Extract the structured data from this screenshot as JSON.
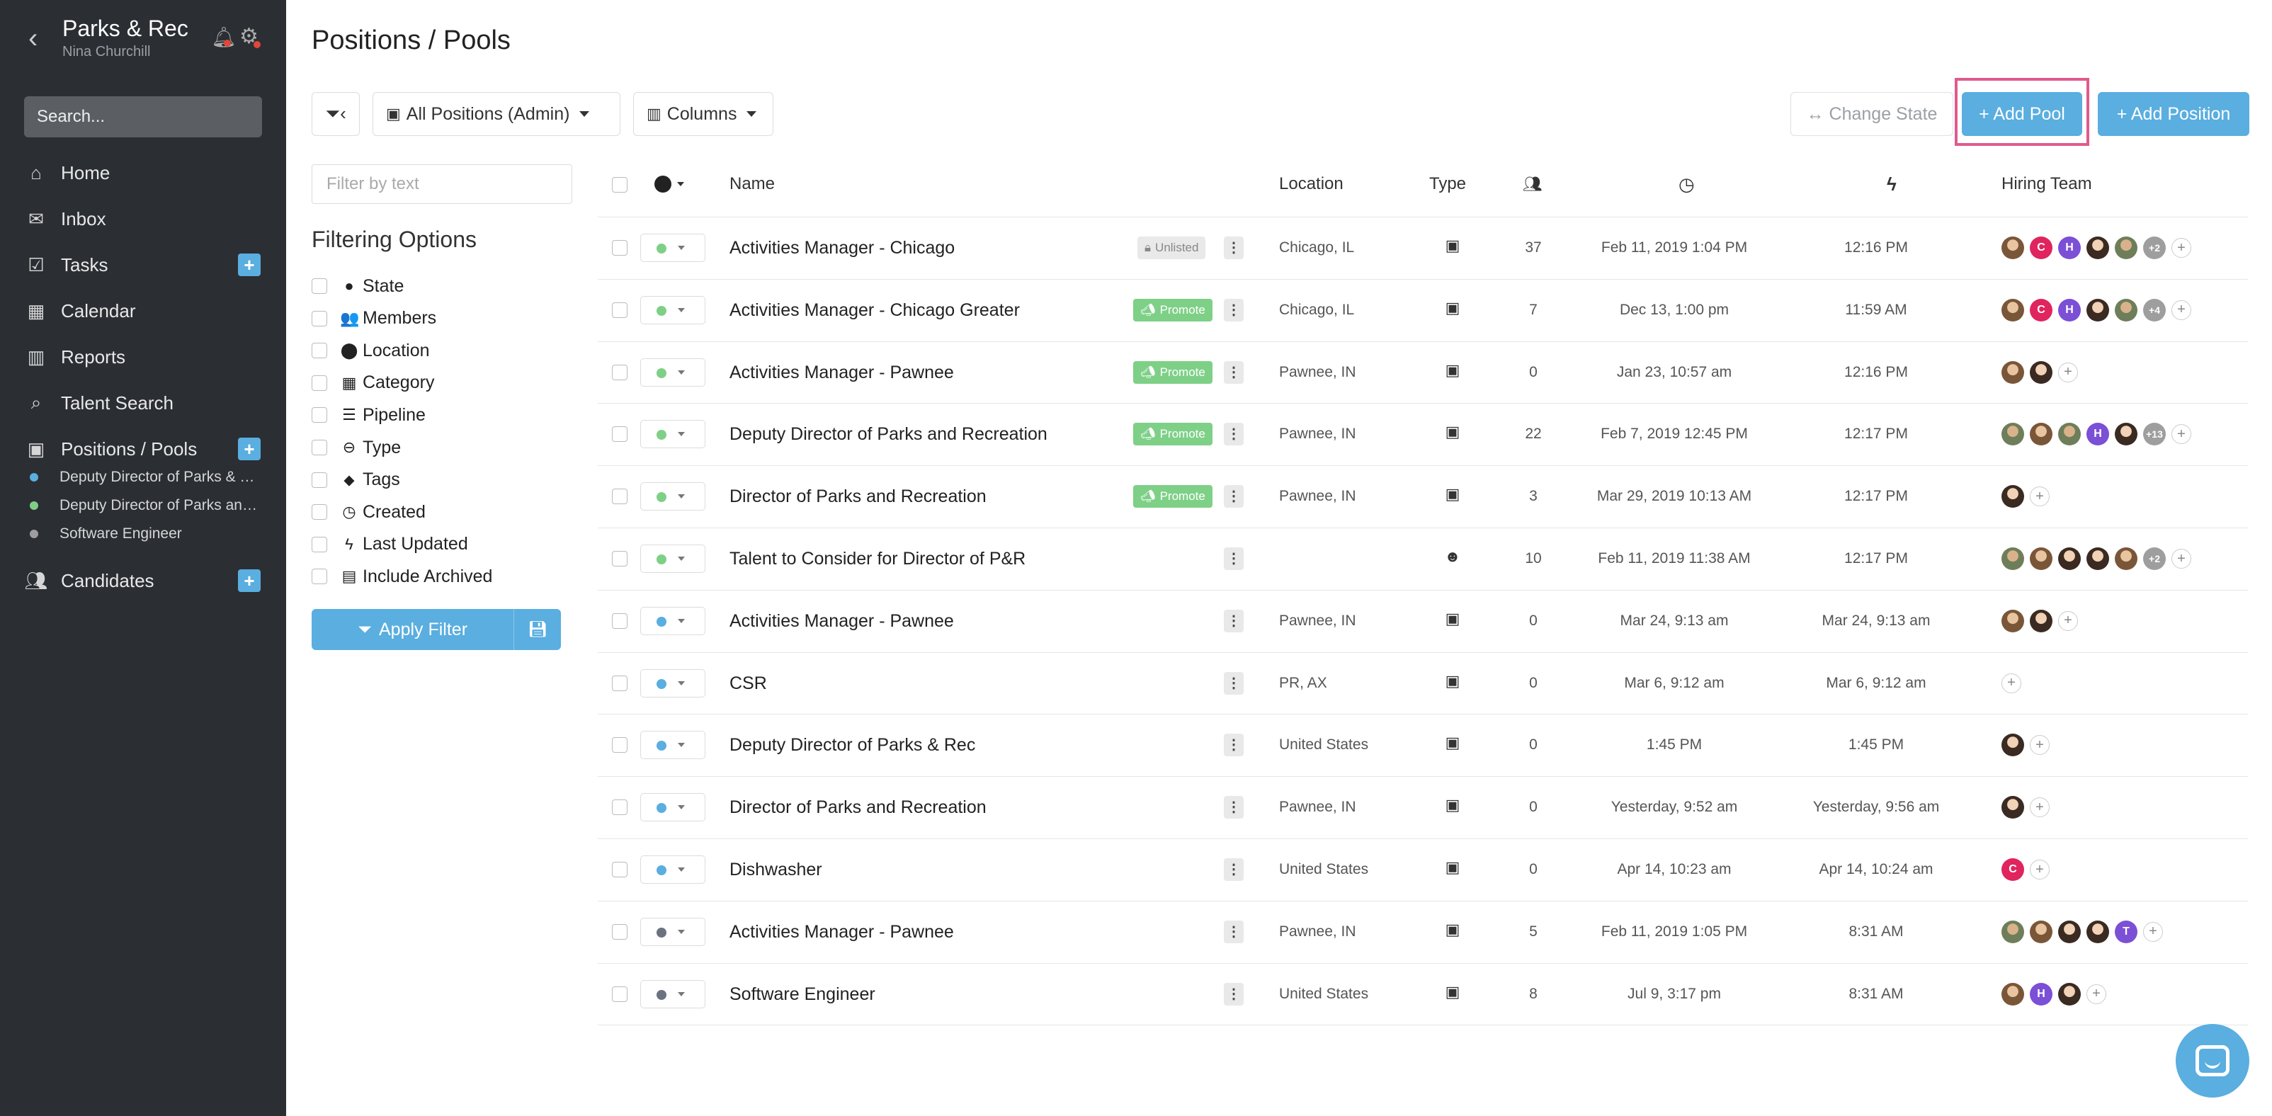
{
  "sidebar": {
    "back_icon": "chevron-left-icon",
    "org_name": "Parks & Rec",
    "user_name": "Nina Churchill",
    "search_placeholder": "Search...",
    "items": [
      {
        "label": "Home",
        "icon": "home-icon"
      },
      {
        "label": "Inbox",
        "icon": "envelope-icon"
      },
      {
        "label": "Tasks",
        "icon": "checkbox-icon"
      },
      {
        "label": "Calendar",
        "icon": "calendar-icon"
      },
      {
        "label": "Reports",
        "icon": "bar-chart-icon"
      },
      {
        "label": "Talent Search",
        "icon": "search-icon"
      },
      {
        "label": "Positions / Pools",
        "icon": "briefcase-icon"
      },
      {
        "label": "Candidates",
        "icon": "users-icon"
      }
    ],
    "sub_items": [
      {
        "label": "Deputy Director of Parks & Recreation",
        "color": "#5aaee0"
      },
      {
        "label": "Deputy Director of Parks and Recreation",
        "color": "#7ed087"
      },
      {
        "label": "Software Engineer",
        "color": "#9e9e9e"
      }
    ],
    "plus": "+"
  },
  "header": {
    "title": "Positions / Pools",
    "view_select": "All Positions (Admin)",
    "columns_label": "Columns",
    "change_state": "↔ Change State",
    "add_pool": "+ Add Pool",
    "add_position": "+ Add Position"
  },
  "filters": {
    "text_placeholder": "Filter by text",
    "title": "Filtering Options",
    "options": [
      {
        "label": "State",
        "icon": "●"
      },
      {
        "label": "Members",
        "icon": "👥"
      },
      {
        "label": "Location",
        "icon": "⬤"
      },
      {
        "label": "Category",
        "icon": "▦"
      },
      {
        "label": "Pipeline",
        "icon": "☰"
      },
      {
        "label": "Type",
        "icon": "⊖"
      },
      {
        "label": "Tags",
        "icon": "⬥"
      },
      {
        "label": "Created",
        "icon": "◷"
      },
      {
        "label": "Last Updated",
        "icon": "ϟ"
      },
      {
        "label": "Include Archived",
        "icon": "▤"
      }
    ],
    "apply_label": "Apply Filter"
  },
  "table": {
    "columns": {
      "name": "Name",
      "location": "Location",
      "type": "Type",
      "hiring_team": "Hiring Team"
    },
    "rows": [
      {
        "name": "Activities Manager - Chicago",
        "badge": "Unlisted",
        "location": "Chicago, IL",
        "type": "briefcase",
        "members": "37",
        "created": "Feb 11, 2019 1:04 PM",
        "updated": "12:16 PM",
        "state": "#7ed087",
        "team": [
          "p1",
          "C",
          "H",
          "p2",
          "p3",
          "+2"
        ]
      },
      {
        "name": "Activities Manager - Chicago Greater",
        "badge": "Promote",
        "location": "Chicago, IL",
        "type": "briefcase",
        "members": "7",
        "created": "Dec 13, 1:00 pm",
        "updated": "11:59 AM",
        "state": "#7ed087",
        "team": [
          "p1",
          "C",
          "H",
          "p2",
          "p3",
          "+4"
        ]
      },
      {
        "name": "Activities Manager - Pawnee",
        "badge": "Promote",
        "location": "Pawnee, IN",
        "type": "briefcase",
        "members": "0",
        "created": "Jan 23, 10:57 am",
        "updated": "12:16 PM",
        "state": "#7ed087",
        "team": [
          "p1",
          "p2"
        ]
      },
      {
        "name": "Deputy Director of Parks and Recreation",
        "badge": "Promote",
        "location": "Pawnee, IN",
        "type": "briefcase",
        "members": "22",
        "created": "Feb 7, 2019 12:45 PM",
        "updated": "12:17 PM",
        "state": "#7ed087",
        "team": [
          "p3",
          "p1",
          "p3",
          "H",
          "p2",
          "+13"
        ]
      },
      {
        "name": "Director of Parks and Recreation",
        "badge": "Promote",
        "location": "Pawnee, IN",
        "type": "briefcase",
        "members": "3",
        "created": "Mar 29, 2019 10:13 AM",
        "updated": "12:17 PM",
        "state": "#7ed087",
        "team": [
          "p2"
        ]
      },
      {
        "name": "Talent to Consider for Director of P&R",
        "badge": "",
        "location": "",
        "type": "user",
        "members": "10",
        "created": "Feb 11, 2019 11:38 AM",
        "updated": "12:17 PM",
        "state": "#7ed087",
        "team": [
          "p3",
          "p1",
          "p2",
          "p2",
          "p1",
          "+2"
        ]
      },
      {
        "name": "Activities Manager - Pawnee",
        "badge": "",
        "location": "Pawnee, IN",
        "type": "briefcase",
        "members": "0",
        "created": "Mar 24, 9:13 am",
        "updated": "Mar 24, 9:13 am",
        "state": "#5aaee0",
        "team": [
          "p1",
          "p2"
        ]
      },
      {
        "name": "CSR",
        "badge": "",
        "location": "PR, AX",
        "type": "briefcase",
        "members": "0",
        "created": "Mar 6, 9:12 am",
        "updated": "Mar 6, 9:12 am",
        "state": "#5aaee0",
        "team": []
      },
      {
        "name": "Deputy Director of Parks & Rec",
        "badge": "",
        "location": "United States",
        "type": "briefcase",
        "members": "0",
        "created": "1:45 PM",
        "updated": "1:45 PM",
        "state": "#5aaee0",
        "team": [
          "p2"
        ]
      },
      {
        "name": "Director of Parks and Recreation",
        "badge": "",
        "location": "Pawnee, IN",
        "type": "briefcase",
        "members": "0",
        "created": "Yesterday, 9:52 am",
        "updated": "Yesterday, 9:56 am",
        "state": "#5aaee0",
        "team": [
          "p2"
        ]
      },
      {
        "name": "Dishwasher",
        "badge": "",
        "location": "United States",
        "type": "briefcase",
        "members": "0",
        "created": "Apr 14, 10:23 am",
        "updated": "Apr 14, 10:24 am",
        "state": "#5aaee0",
        "team": [
          "C"
        ]
      },
      {
        "name": "Activities Manager - Pawnee",
        "badge": "",
        "location": "Pawnee, IN",
        "type": "briefcase",
        "members": "5",
        "created": "Feb 11, 2019 1:05 PM",
        "updated": "8:31 AM",
        "state": "#6b7280",
        "team": [
          "p3",
          "p1",
          "p2",
          "p2",
          "T"
        ]
      },
      {
        "name": "Software Engineer",
        "badge": "",
        "location": "United States",
        "type": "briefcase",
        "members": "8",
        "created": "Jul 9, 3:17 pm",
        "updated": "8:31 AM",
        "state": "#6b7280",
        "team": [
          "p1",
          "H",
          "p2"
        ]
      }
    ]
  },
  "colors": {
    "accent": "#5aaee0",
    "promote": "#7ed087",
    "sidebar": "#2b2e33",
    "highlight": "#e05a8c"
  }
}
